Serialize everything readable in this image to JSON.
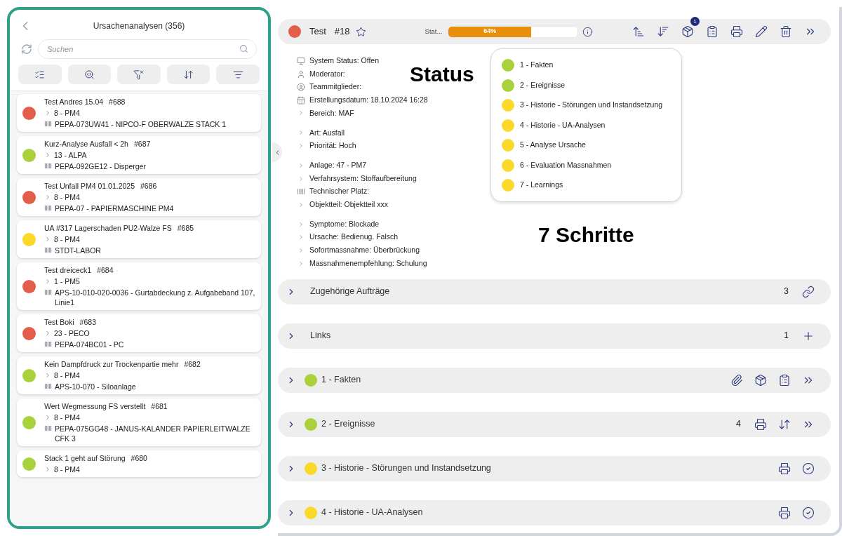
{
  "sidebar": {
    "title": "Ursachenanalysen (356)",
    "search": {
      "placeholder": "Suchen"
    },
    "items": [
      {
        "title": "Test Andres 15.04",
        "number": "#688",
        "area": "8 - PM4",
        "place": "PEPA-073UW41 - NIPCO-F OBERWALZE STACK 1",
        "color": "#e35d4a"
      },
      {
        "title": "Kurz-Analyse Ausfall < 2h",
        "number": "#687",
        "area": "13 - ALPA",
        "place": "PEPA-092GE12 - Disperger",
        "color": "#a8d13c"
      },
      {
        "title": "Test Unfall PM4 01.01.2025",
        "number": "#686",
        "area": "8 - PM4",
        "place": "PEPA-07 - PAPIERMASCHINE PM4",
        "color": "#e35d4a"
      },
      {
        "title": "UA #317 Lagerschaden PU2-Walze FS",
        "number": "#685",
        "area": "8 - PM4",
        "place": "STDT-LABOR",
        "color": "#fbd92b"
      },
      {
        "title": "Test dreiceck1",
        "number": "#684",
        "area": "1 - PM5",
        "place": "APS-10-010-020-0036 - Gurtabdeckung z. Aufgabeband 107, Linie1",
        "color": "#e35d4a"
      },
      {
        "title": "Test Boki",
        "number": "#683",
        "area": "23 - PECO",
        "place": "PEPA-074BC01 - PC",
        "color": "#e35d4a"
      },
      {
        "title": "Kein Dampfdruck zur Trockenpartie mehr",
        "number": "#682",
        "area": "8 - PM4",
        "place": "APS-10-070 - Siloanlage",
        "color": "#a8d13c"
      },
      {
        "title": "Wert Wegmessung FS verstellt",
        "number": "#681",
        "area": "8 - PM4",
        "place": "PEPA-075GG48 - JANUS-KALANDER PAPIERLEITWALZE CFK 3",
        "color": "#a8d13c"
      },
      {
        "title": "Stack 1 geht auf Störung",
        "number": "#680",
        "area": "8 - PM4",
        "color": "#a8d13c"
      }
    ]
  },
  "header": {
    "color": "#e35d4a",
    "title": "Test",
    "number": "#18",
    "progress": {
      "label": "Stat...",
      "level": 0.64,
      "reading": "64%"
    },
    "badge": "1"
  },
  "details": [
    [
      {
        "kind": "monitor",
        "label": "System Status: Offen"
      },
      {
        "kind": "user",
        "label": "Moderator:"
      },
      {
        "kind": "users",
        "label": "Teammitglieder:"
      },
      {
        "kind": "calendar",
        "label": "Erstellungsdatum: 18.10.2024 16:28"
      },
      {
        "kind": "chevron",
        "label": "Bereich: MAF"
      }
    ],
    [
      {
        "kind": "chevron",
        "label": "Art: Ausfall"
      },
      {
        "kind": "chevron",
        "label": "Priorität: Hoch"
      }
    ],
    [
      {
        "kind": "chevron",
        "label": "Anlage: 47 - PM7"
      },
      {
        "kind": "chevron",
        "label": "Verfahrsystem: Stoffaufbereitung"
      },
      {
        "kind": "place",
        "label": "Technischer Platz:"
      },
      {
        "kind": "chevron",
        "label": "Objektteil: Objektteil xxx"
      }
    ],
    [
      {
        "kind": "chevron",
        "label": "Symptome: Blockade"
      },
      {
        "kind": "chevron",
        "label": "Ursache: Bedienug. Falsch"
      },
      {
        "kind": "chevron",
        "label": "Sofortmassnahme: Überbrückung"
      },
      {
        "kind": "chevron",
        "label": "Massnahmenempfehlung: Schulung"
      }
    ]
  ],
  "steps_popup": [
    {
      "label": "1 - Fakten",
      "color": "#a8d13c"
    },
    {
      "label": "2 - Ereignisse",
      "color": "#a8d13c"
    },
    {
      "label": "3 - Historie - Störungen und Instandsetzung",
      "color": "#fbd92b"
    },
    {
      "label": "4 - Historie - UA-Analysen",
      "color": "#fbd92b"
    },
    {
      "label": "5 - Analyse Ursache",
      "color": "#fbd92b"
    },
    {
      "label": "6 - Evaluation Massnahmen",
      "color": "#fbd92b"
    },
    {
      "label": "7 - Learnings",
      "color": "#fbd92b"
    }
  ],
  "annotations": [
    "Status",
    "7 Schritte"
  ],
  "sections": [
    {
      "kind": "orders",
      "label": "Zugehörige Aufträge",
      "count": "3"
    },
    {
      "kind": "links",
      "label": "Links",
      "count": "1"
    },
    {
      "kind": "facts",
      "label": "1 - Fakten",
      "color": "#a8d13c"
    },
    {
      "kind": "events",
      "label": "2 - Ereignisse",
      "color": "#a8d13c",
      "count": "4"
    },
    {
      "kind": "history",
      "label": "3 - Historie - Störungen und Instandsetzung",
      "color": "#fbd92b"
    },
    {
      "kind": "history",
      "label": "4 - Historie - UA-Analysen",
      "color": "#fbd92b"
    }
  ]
}
